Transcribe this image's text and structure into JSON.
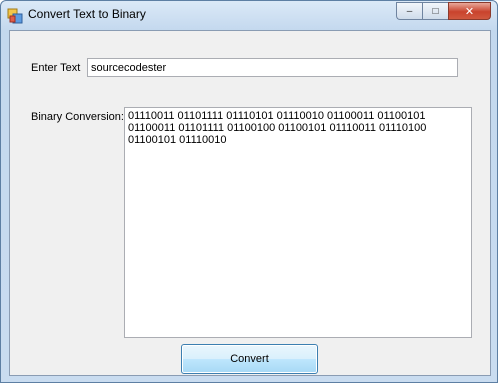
{
  "window": {
    "title": "Convert Text to Binary",
    "buttons": {
      "minimize": "‒",
      "maximize": "□",
      "close": "✕"
    }
  },
  "form": {
    "enter_text_label": "Enter Text",
    "input_value": "sourcecodester",
    "binary_label": "Binary Conversion:",
    "binary_output": "01110011 01101111 01110101 01110010 01100011 01100101 01100011 01101111 01100100 01100101 01110011 01110100 01100101 01110010",
    "convert_button": "Convert"
  }
}
